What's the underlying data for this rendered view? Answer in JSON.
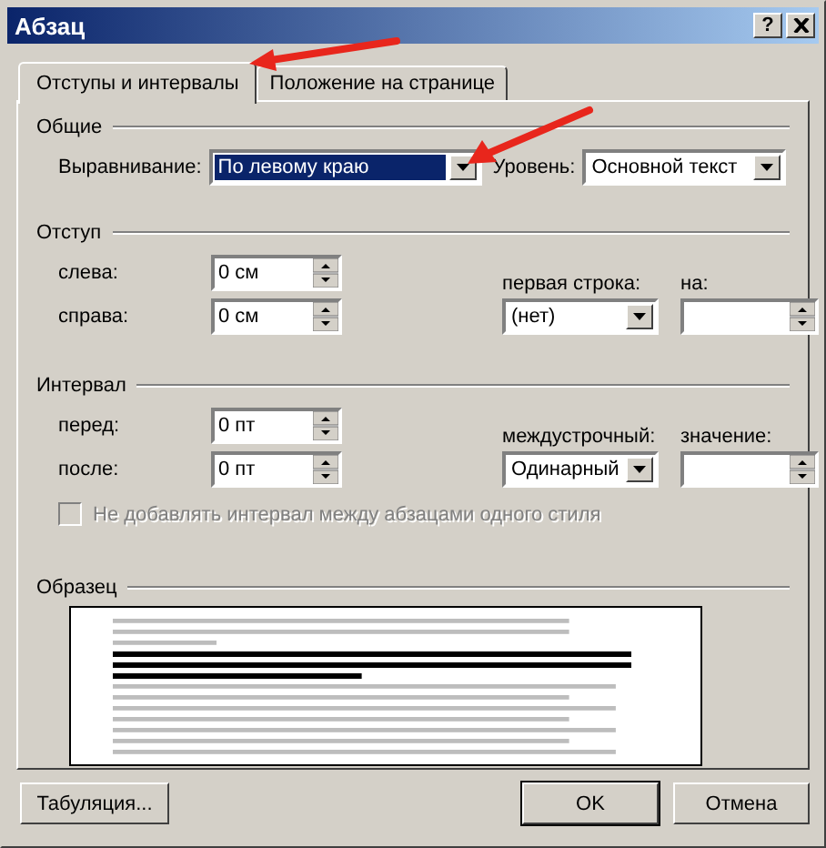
{
  "window": {
    "title": "Абзац",
    "help": "?"
  },
  "tabs": [
    {
      "label": "Отступы и интервалы",
      "selected": true
    },
    {
      "label": "Положение на странице",
      "selected": false
    }
  ],
  "general": {
    "title": "Общие",
    "alignment": {
      "label": "Выравнивание:",
      "value": "По левому краю",
      "highlighted": true
    },
    "level": {
      "label": "Уровень:",
      "value": "Основной текст",
      "highlighted": false
    }
  },
  "indent": {
    "title": "Отступ",
    "left": {
      "label": "слева:",
      "value": "0 см"
    },
    "right": {
      "label": "справа:",
      "value": "0 см"
    },
    "first_line": {
      "label": "первая строка:",
      "value": "(нет)"
    },
    "by": {
      "label": "на:"
    }
  },
  "spacing": {
    "title": "Интервал",
    "before": {
      "label": "перед:",
      "value": "0 пт"
    },
    "after": {
      "label": "после:",
      "value": "0 пт"
    },
    "line_spacing": {
      "label": "междустрочный:",
      "value": "Одинарный"
    },
    "at": {
      "label": "значение:"
    },
    "no_space_same_style": {
      "label": "Не добавлять интервал между абзацами одного стиля",
      "checked": false,
      "disabled": true
    }
  },
  "preview": {
    "title": "Образец"
  },
  "buttons": [
    {
      "label": "Табуляция...",
      "default": false
    },
    {
      "label": "OK",
      "default": true
    },
    {
      "label": "Отмена",
      "default": false
    }
  ]
}
